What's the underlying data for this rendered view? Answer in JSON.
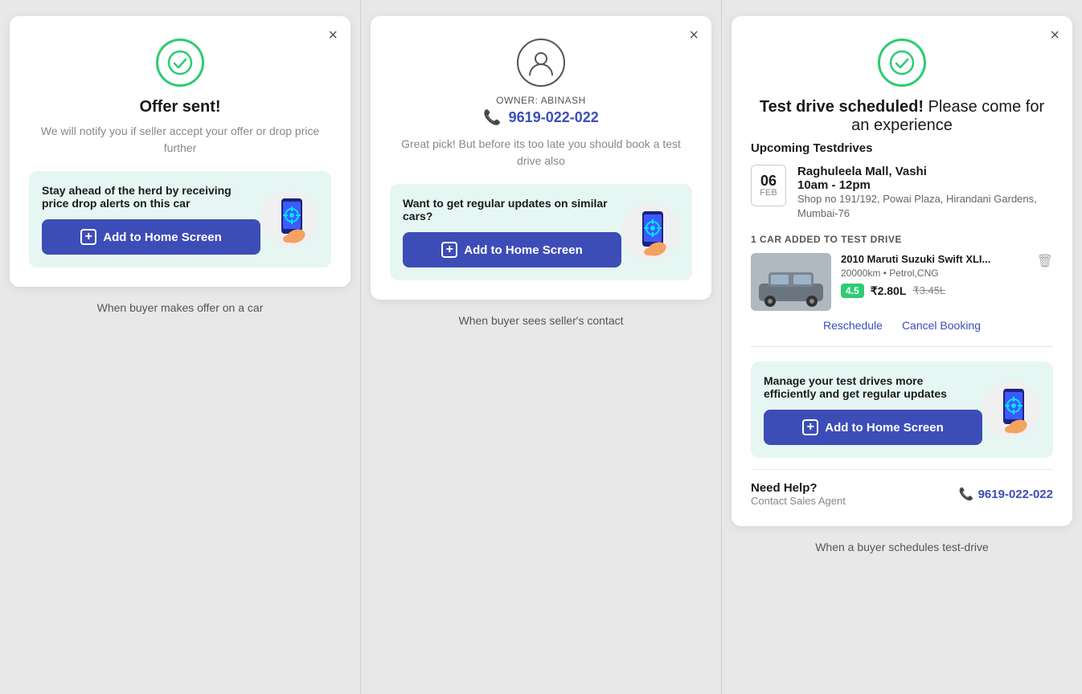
{
  "panel1": {
    "close_label": "×",
    "title": "Offer sent!",
    "subtitle": "We will notify you if seller accept your offer or drop price further",
    "banner_text": "Stay ahead of the herd by receiving price drop alerts on this car",
    "add_btn_label": "Add to Home Screen",
    "bottom_label": "When buyer makes offer on a car"
  },
  "panel2": {
    "close_label": "×",
    "owner_label": "OWNER: ABINASH",
    "owner_phone": "9619-022-022",
    "body_text": "Great pick! But before its too late you should book a test drive also",
    "banner_text": "Want to get regular updates on similar cars?",
    "add_btn_label": "Add to Home Screen",
    "bottom_label": "When buyer sees seller's contact"
  },
  "panel3": {
    "close_label": "×",
    "title_bold": "Test drive scheduled!",
    "title_normal": " Please come for an experience",
    "upcoming_label": "Upcoming Testdrives",
    "testdrive": {
      "day": "06",
      "month": "FEB",
      "venue": "Raghuleela Mall, Vashi",
      "time": "10am - 12pm",
      "address": "Shop no 191/192, Powai Plaza, Hirandani Gardens, Mumbai-76"
    },
    "car_added_label": "1 CAR ADDED TO TEST DRIVE",
    "car": {
      "name": "2010 Maruti Suzuki Swift XLI...",
      "meta": "20000km • Petrol,CNG",
      "rating": "4.5",
      "price": "₹2.80L",
      "price_old": "₹3.45L"
    },
    "reschedule_label": "Reschedule",
    "cancel_label": "Cancel Booking",
    "banner_text": "Manage your test drives more efficiently and get regular updates",
    "add_btn_label": "Add to Home Screen",
    "need_help_title": "Need Help?",
    "need_help_sub": "Contact Sales Agent",
    "need_help_phone": "9619-022-022",
    "bottom_label": "When a buyer schedules test-drive"
  }
}
